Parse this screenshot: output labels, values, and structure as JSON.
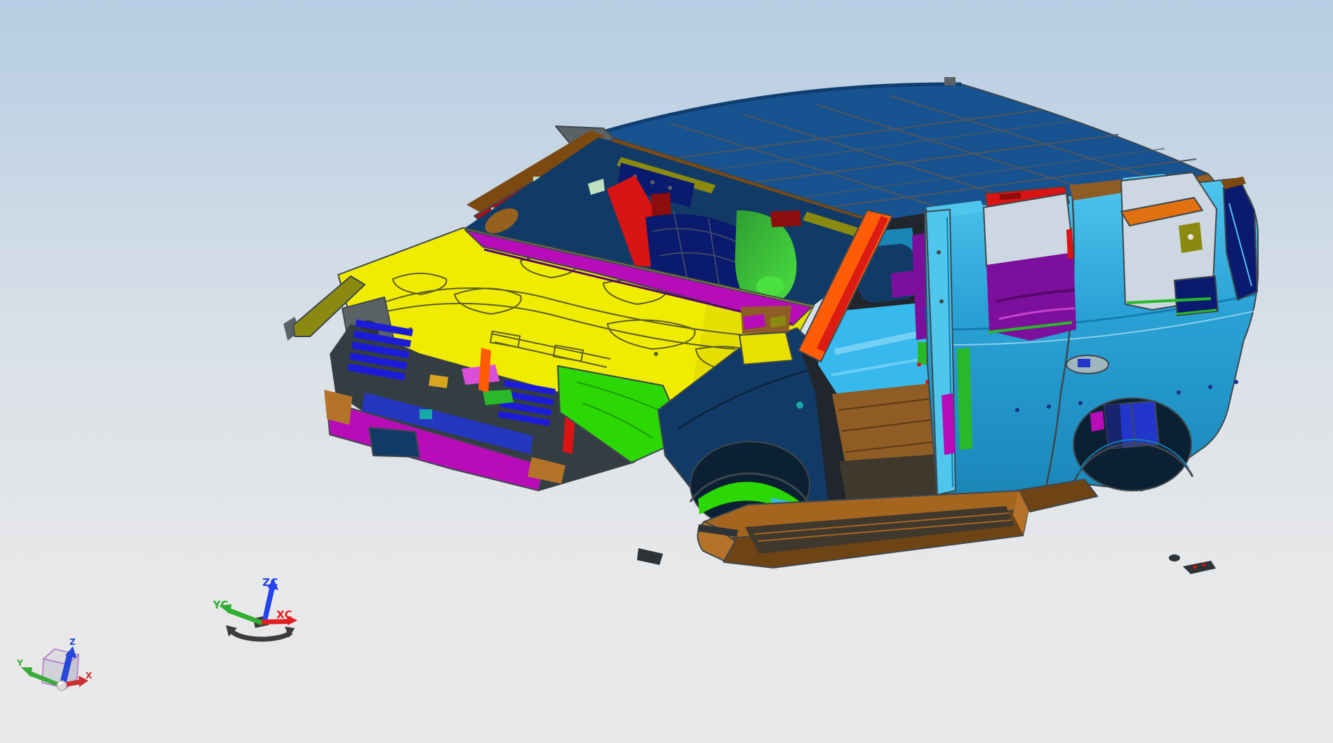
{
  "app": {
    "name": "cad-3d-viewport",
    "description": "shaded body-in-white car model view"
  },
  "background": {
    "top": "#b5cde2",
    "mid": "#d9e0e8",
    "low": "#e7e8e9",
    "bottom": "#e9e9e9"
  },
  "wcs_triad": {
    "z_label": "ZC",
    "y_label": "YC",
    "x_label": "XC",
    "z_color": "#2343ee",
    "y_color": "#2fae2f",
    "x_color": "#e02020",
    "handle_color": "#3c3c3c"
  },
  "datum_triad": {
    "z_label": "Z",
    "y_label": "Y",
    "x_label": "X",
    "z_color": "#2747d8",
    "y_color": "#3aaa3a",
    "x_color": "#cc3030",
    "cube_edge": "#b473c8",
    "cube_face_top": "#dcdce2",
    "cube_face_front": "#d2d2da",
    "cube_face_side": "#c6c6ce",
    "origin": "#dcdcdc"
  },
  "model": {
    "colors": {
      "edge": "#3f474e",
      "roof": "#175390",
      "roof_grid": "#4e575f",
      "roof_edge": "#0f3f70",
      "trim_brown": "#7c4a10",
      "trim_brown_light": "#96601e",
      "olive": "#8a8a10",
      "body_top": "#4fc6ee",
      "body_mid": "#2aa2d6",
      "body_deep": "#1a86b8",
      "pillar_cyan": "#4fc6ee",
      "red": "#d81414",
      "dark_red": "#8e0d0d",
      "crimson": "#a81212",
      "orange": "#ff5c08",
      "orange_deep": "#e07010",
      "hood": "#f0ec00",
      "hood_shadow": "#d4d000",
      "hood_line": "#5f5f28",
      "magenta": "#b80cb8",
      "pink": "#d94fd9",
      "purple": "#7c109c",
      "purple_dark": "#56086e",
      "navy": "#113a66",
      "navy_deep": "#0b2033",
      "navy_inner": "#0a1a6e",
      "grille_blue": "#1c1cd8",
      "royal_blue": "#2336cc",
      "royal_shadow": "#18246e",
      "floor_green": "#2bd804",
      "green_stamp": "#1e9e08",
      "inner_green": "#2f9e33",
      "inner_green_hi": "#4ae040",
      "green_strip": "#28b828",
      "floor_brown": "#8f5c26",
      "tunnel_line": "#5e3a12",
      "floor_cyan": "#38b9ee",
      "floor_cyan_hi": "#8fdcf8",
      "rocker_top": "#a5651f",
      "rocker_side": "#6e4414",
      "rocker_dark": "#3f382c",
      "rocker_cap": "#b5732a",
      "gray": "#5a6266",
      "dark": "#2e3338",
      "slate": "#343d42",
      "teal": "#18a8a8",
      "gold": "#d8a520",
      "yellow_part": "#e8e000",
      "window_bg": "#ccd7e2",
      "belt_line": "#147dae",
      "belt_hi": "#cfeffa",
      "sill_shadow": "#20262b",
      "rivet": "#1b2f8e",
      "pale_bit": "#bfe0c0",
      "handle_gray": "#9fb6bf"
    }
  }
}
